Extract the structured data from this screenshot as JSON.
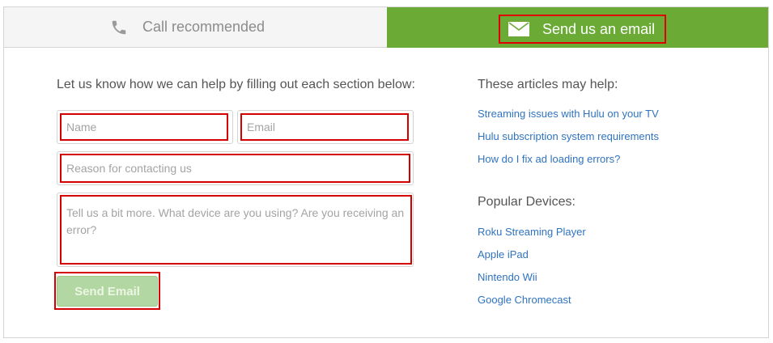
{
  "tabs": {
    "call": {
      "label": "Call recommended",
      "icon": "phone-icon"
    },
    "email": {
      "label": "Send us an email",
      "icon": "envelope-icon",
      "active": true
    }
  },
  "form": {
    "intro": "Let us know how we can help by filling out each section below:",
    "name_placeholder": "Name",
    "email_placeholder": "Email",
    "reason_placeholder": "Reason for contacting us",
    "details_placeholder": "Tell us a bit more. What device are you using? Are you receiving an error?",
    "submit_label": "Send Email"
  },
  "sidebar": {
    "articles_heading": "These articles may help:",
    "articles": [
      "Streaming issues with Hulu on your TV",
      "Hulu subscription system requirements",
      "How do I fix ad loading errors?"
    ],
    "devices_heading": "Popular Devices:",
    "devices": [
      "Roku Streaming Player",
      "Apple iPad",
      "Nintendo Wii",
      "Google Chromecast"
    ]
  },
  "colors": {
    "active_tab": "#6aaa35",
    "link": "#2f73c0",
    "highlight": "#d40000"
  }
}
